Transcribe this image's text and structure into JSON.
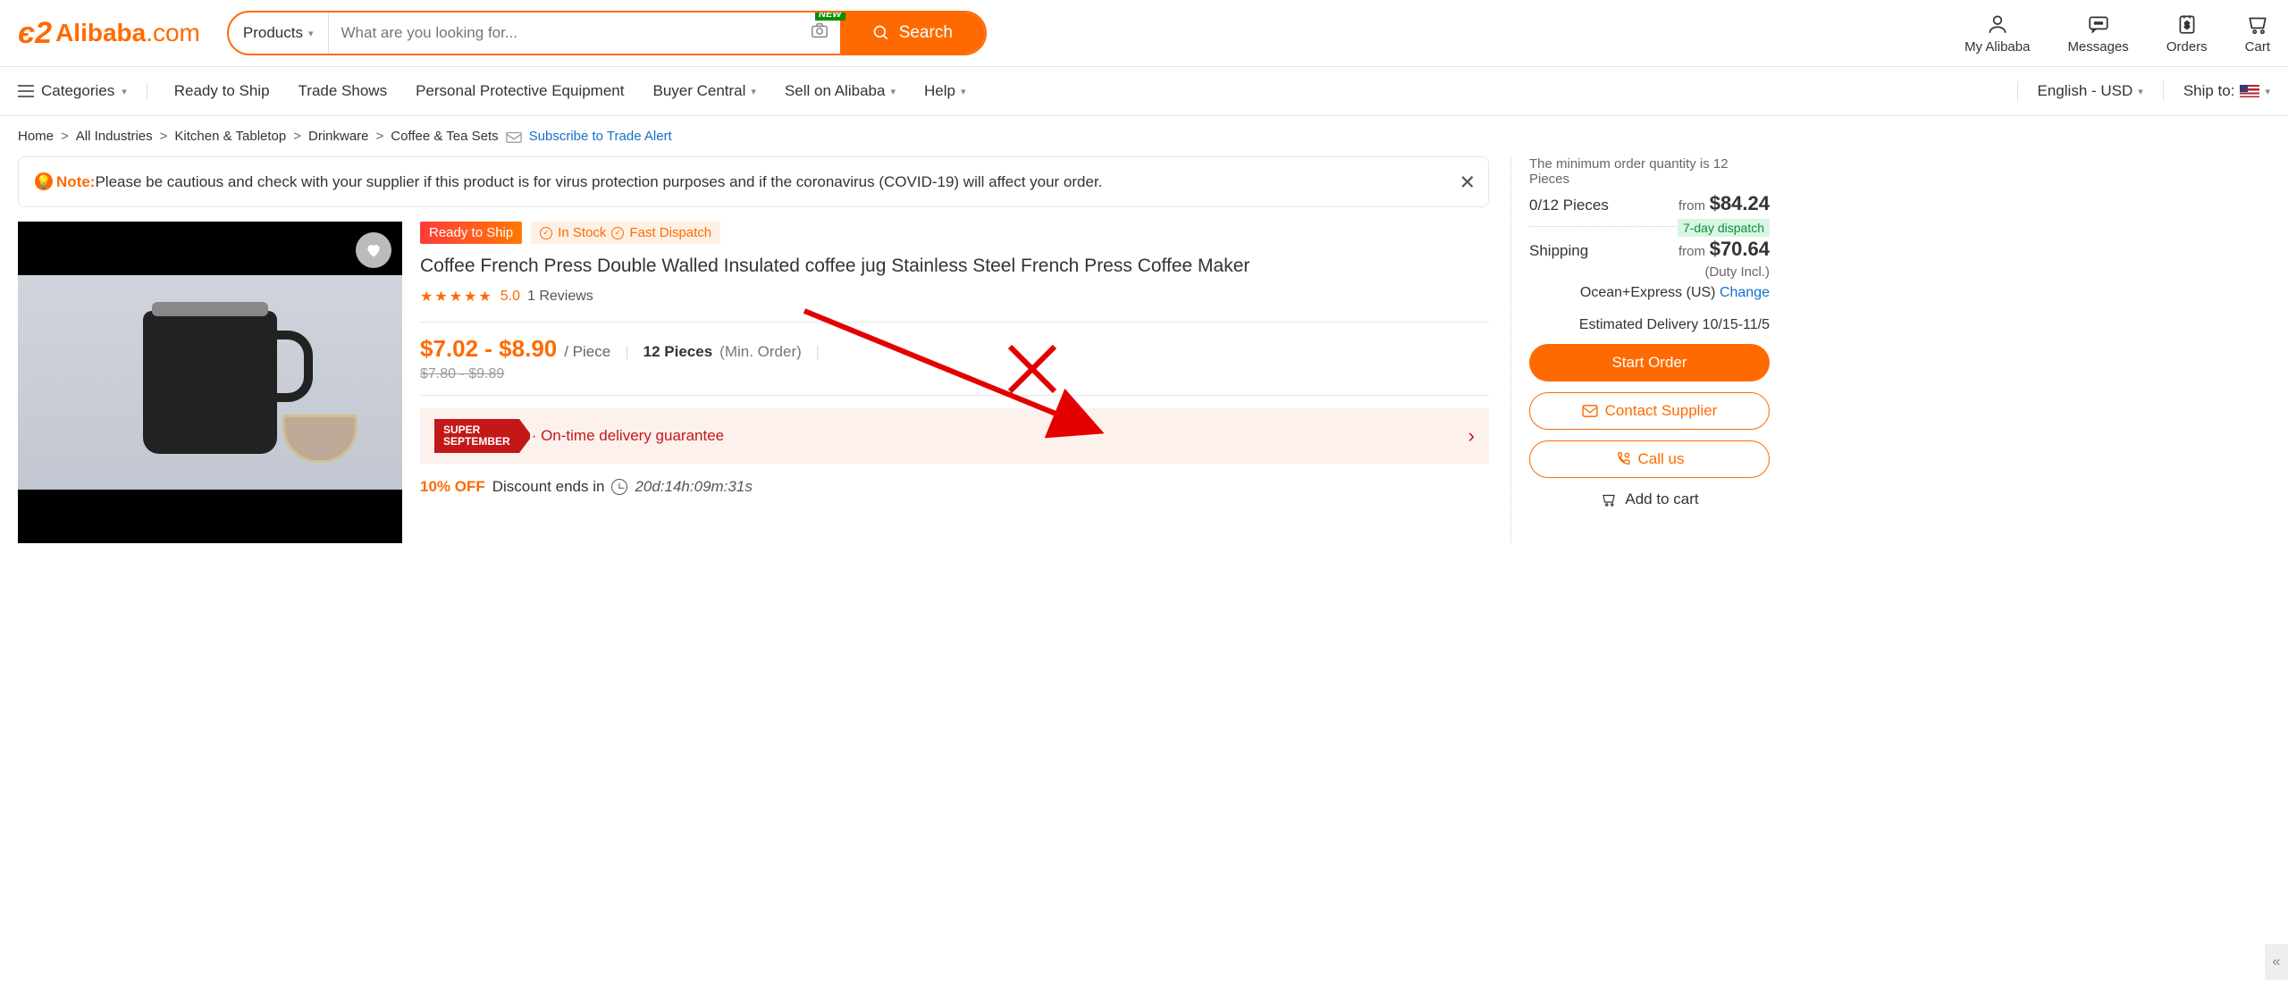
{
  "header": {
    "logo_main": "Alibaba",
    "logo_suffix": ".com",
    "search_category": "Products",
    "search_placeholder": "What are you looking for...",
    "new_badge": "NEW",
    "search_button": "Search",
    "links": {
      "my_alibaba": "My Alibaba",
      "messages": "Messages",
      "orders": "Orders",
      "cart": "Cart"
    }
  },
  "nav": {
    "categories": "Categories",
    "items": [
      "Ready to Ship",
      "Trade Shows",
      "Personal Protective Equipment",
      "Buyer Central",
      "Sell on Alibaba",
      "Help"
    ],
    "locale": "English - USD",
    "ship_to": "Ship to:"
  },
  "breadcrumb": {
    "items": [
      "Home",
      "All Industries",
      "Kitchen & Tabletop",
      "Drinkware",
      "Coffee & Tea Sets"
    ],
    "subscribe": "Subscribe to Trade Alert"
  },
  "note": {
    "label": "Note:",
    "text": "Please be cautious and check with your supplier if this product is for virus protection purposes and if the coronavirus (COVID-19) will affect your order."
  },
  "product": {
    "ready_to_ship": "Ready to Ship",
    "in_stock": "In Stock",
    "fast_dispatch": "Fast Dispatch",
    "title": "Coffee French Press Double Walled Insulated coffee jug Stainless Steel French Press Coffee Maker",
    "rating": "5.0",
    "reviews": "1 Reviews",
    "price_range": "$7.02 - $8.90",
    "price_unit": "/ Piece",
    "min_order_qty": "12 Pieces",
    "min_order_label": "(Min. Order)",
    "old_price": "$7.80 - $9.89",
    "super_september_line1": "SUPER",
    "super_september_line2": "SEPTEMBER",
    "promo_text": "· On-time delivery guarantee",
    "discount_pct": "10% OFF",
    "discount_label": "Discount ends in",
    "countdown": "20d:14h:09m:31s"
  },
  "order_panel": {
    "moq_text": "The minimum order quantity is 12 Pieces",
    "pieces": "0/12 Pieces",
    "from_label": "from",
    "price": "$84.24",
    "dispatch": "7-day dispatch",
    "shipping_label": "Shipping",
    "shipping_price": "$70.64",
    "duty": "(Duty Incl.)",
    "ship_method": "Ocean+Express (US)",
    "change": "Change",
    "est_delivery": "Estimated Delivery 10/15-11/5",
    "start_order": "Start Order",
    "contact_supplier": "Contact Supplier",
    "call_us": "Call us",
    "add_to_cart": "Add to cart"
  }
}
